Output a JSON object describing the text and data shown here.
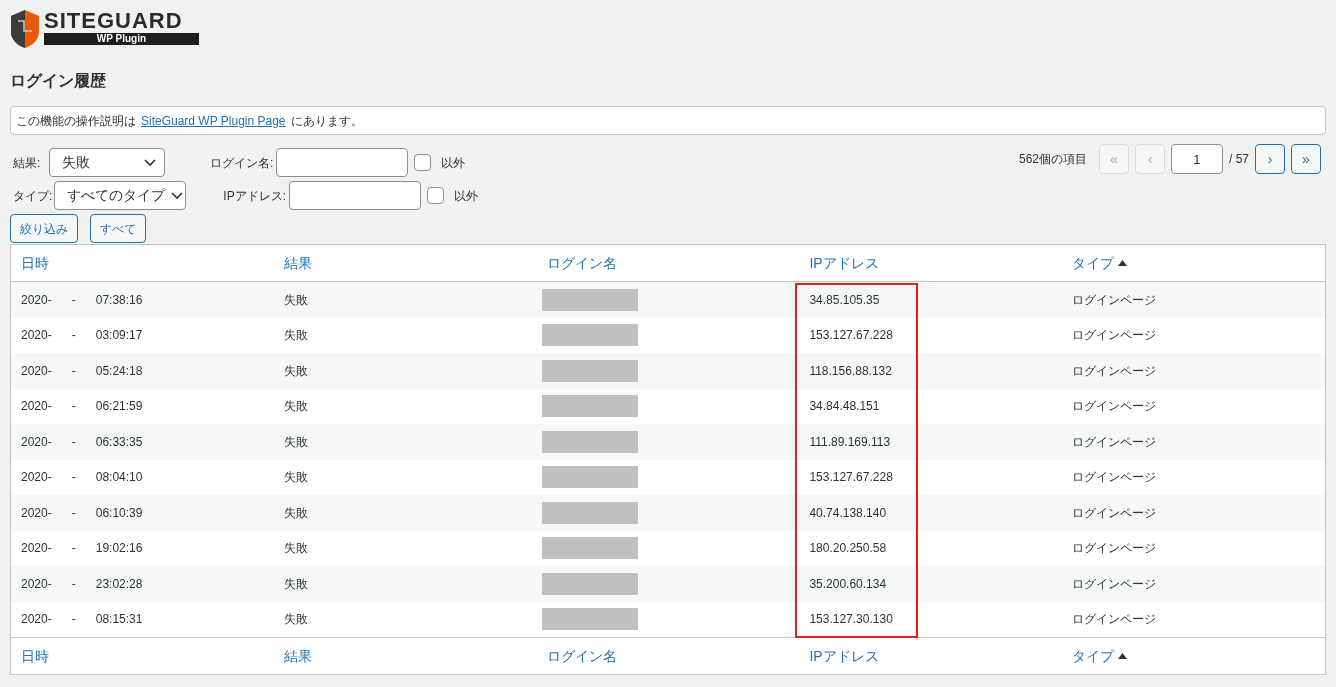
{
  "logo": {
    "title": "SITEGUARD",
    "subtitle": "WP Plugin"
  },
  "page_title": "ログイン履歴",
  "notice": {
    "before": "この機能の操作説明は",
    "link": "SiteGuard WP Plugin Page",
    "after": "にあります。"
  },
  "filters": {
    "result": {
      "label": "結果:",
      "value": "失敗"
    },
    "type": {
      "label": "タイプ:",
      "value": "すべてのタイプ"
    },
    "login_name": {
      "label": "ログイン名:",
      "exclude_label": "以外",
      "exclude_checked": false
    },
    "ip": {
      "label": "IPアドレス:",
      "exclude_label": "以外",
      "exclude_checked": false
    },
    "buttons": [
      "絞り込み",
      "すべて"
    ]
  },
  "pagination": {
    "count": "562個の項目",
    "first": {
      "label": "«",
      "disabled": true
    },
    "prev": {
      "label": "‹",
      "disabled": true
    },
    "page": "1",
    "total": "/ 57",
    "next": {
      "label": "›",
      "disabled": false
    },
    "last": {
      "label": "»",
      "disabled": false
    }
  },
  "table": {
    "columns": [
      {
        "label": "日時",
        "sorted": false,
        "highlighted": false
      },
      {
        "label": "結果",
        "sorted": false,
        "highlighted": false
      },
      {
        "label": "ログイン名",
        "sorted": false,
        "highlighted": false
      },
      {
        "label": "IPアドレス",
        "sorted": false,
        "highlighted": true
      },
      {
        "label": "タイプ",
        "sorted": true,
        "highlighted": false
      }
    ],
    "footer_columns": [
      {
        "label": "日時",
        "sorted": false
      },
      {
        "label": "結果",
        "sorted": false
      },
      {
        "label": "ログイン名",
        "sorted": false
      },
      {
        "label": "IPアドレス",
        "sorted": false
      },
      {
        "label": "タイプ",
        "sorted": true
      }
    ],
    "rows": [
      {
        "date": "2020-",
        "separator": "-",
        "time": "07:38:16",
        "result": "失敗",
        "ip": "34.85.105.35",
        "type": "ログインページ"
      },
      {
        "date": "2020-",
        "separator": "-",
        "time": "03:09:17",
        "result": "失敗",
        "ip": "153.127.67.228",
        "type": "ログインページ"
      },
      {
        "date": "2020-",
        "separator": "-",
        "time": "05:24:18",
        "result": "失敗",
        "ip": "118.156.88.132",
        "type": "ログインページ"
      },
      {
        "date": "2020-",
        "separator": "-",
        "time": "06:21:59",
        "result": "失敗",
        "ip": "34.84.48.151",
        "type": "ログインページ"
      },
      {
        "date": "2020-",
        "separator": "-",
        "time": "06:33:35",
        "result": "失敗",
        "ip": "111.89.169.113",
        "type": "ログインページ"
      },
      {
        "date": "2020-",
        "separator": "-",
        "time": "08:04:10",
        "result": "失敗",
        "ip": "153.127.67.228",
        "type": "ログインページ"
      },
      {
        "date": "2020-",
        "separator": "-",
        "time": "06:10:39",
        "result": "失敗",
        "ip": "40.74.138.140",
        "type": "ログインページ"
      },
      {
        "date": "2020-",
        "separator": "-",
        "time": "19:02:16",
        "result": "失敗",
        "ip": "180.20.250.58",
        "type": "ログインページ"
      },
      {
        "date": "2020-",
        "separator": "-",
        "time": "23:02:28",
        "result": "失敗",
        "ip": "35.200.60.134",
        "type": "ログインページ"
      },
      {
        "date": "2020-",
        "separator": "-",
        "time": "08:15:31",
        "result": "失敗",
        "ip": "153.127.30.130",
        "type": "ログインページ"
      }
    ]
  }
}
